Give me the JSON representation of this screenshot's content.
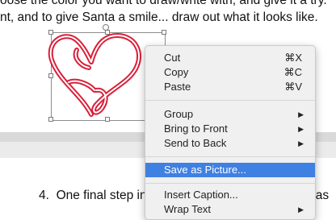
{
  "document": {
    "line1": "oose the color you want to draw/write with, and give it a try.",
    "line2": "nt, and to give Santa a smile... draw out what it looks like.",
    "step_number": "4.",
    "step_text": "One final step in",
    "step_tail": "rt' as"
  },
  "drawing": {
    "stroke_color": "#d9203a",
    "label": "drawn heart shape"
  },
  "context_menu": {
    "items": [
      {
        "label": "Cut",
        "shortcut": "⌘X"
      },
      {
        "label": "Copy",
        "shortcut": "⌘C"
      },
      {
        "label": "Paste",
        "shortcut": "⌘V"
      },
      {
        "label": "Group",
        "submenu_icon": "triangle-right-icon"
      },
      {
        "label": "Bring to Front",
        "submenu_icon": "triangle-right-icon"
      },
      {
        "label": "Send to Back",
        "submenu_icon": "triangle-right-icon"
      },
      {
        "label": "Save as Picture...",
        "highlighted": true
      },
      {
        "label": "Insert Caption..."
      },
      {
        "label": "Wrap Text",
        "submenu_icon": "triangle-right-icon"
      }
    ],
    "highlight_color": "#3f80e3"
  }
}
